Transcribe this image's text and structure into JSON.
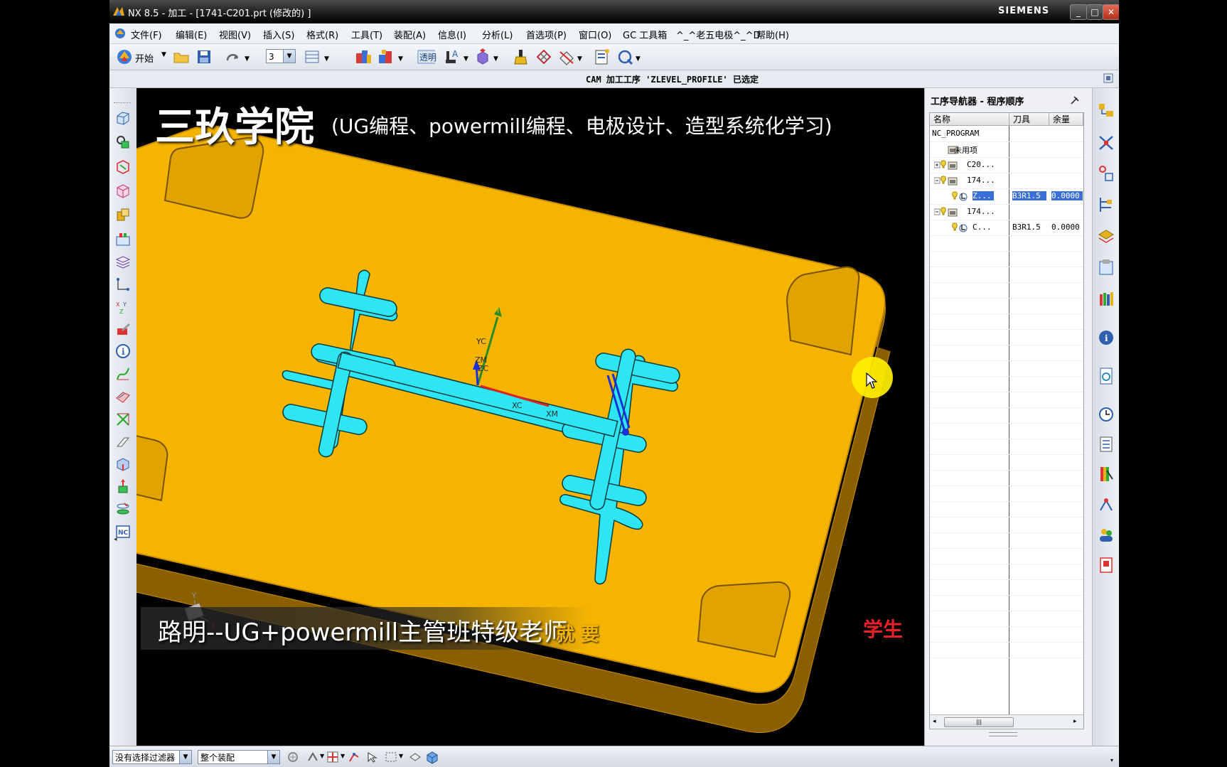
{
  "window": {
    "title": "NX 8.5 - 加工 - [1741-C201.prt (修改的) ]",
    "brand": "SIEMENS",
    "minimize": "_",
    "maximize": "□",
    "close": "✕"
  },
  "menu": [
    "文件(F)",
    "编辑(E)",
    "视图(V)",
    "插入(S)",
    "格式(R)",
    "工具(T)",
    "装配(A)",
    "信息(I)",
    "分析(L)",
    "首选项(P)",
    "窗口(O)",
    "GC 工具箱",
    "^_^老五电极^_^D",
    "帮助(H)"
  ],
  "toolbar": {
    "start_label": "开始",
    "layer_value": "3",
    "transparency_label": "透明"
  },
  "cue_line": "CAM 加工工序 'ZLEVEL_PROFILE' 已选定",
  "overlay": {
    "watermark_title": "三玖学院",
    "watermark_subtitle": "(UG编程、powermill编程、电极设计、造型系统化学习)",
    "caption_left": "路明--UG+powermill主管班特级老师",
    "caption_middle": "就 要",
    "caption_right": "学生"
  },
  "axes": {
    "ym": "YM",
    "yc": "YC",
    "zm": "ZM",
    "zc": "ZC",
    "xc": "XC",
    "xm": "XM",
    "wcs_y": "Y",
    "wcs_x": "X"
  },
  "navigator": {
    "title": "工序导航器 - 程序顺序",
    "columns": [
      "名称",
      "刀具",
      "余量"
    ],
    "rows": [
      {
        "name": "NC_PROGRAM",
        "tool": "",
        "stock": "",
        "level": 0,
        "selected": false
      },
      {
        "name": "未用项",
        "tool": "",
        "stock": "",
        "level": 1,
        "selected": false
      },
      {
        "name": "C20...",
        "tool": "",
        "stock": "",
        "level": 1,
        "selected": false
      },
      {
        "name": "174...",
        "tool": "",
        "stock": "",
        "level": 1,
        "selected": false
      },
      {
        "name": "Z...",
        "tool": "B3R1.5",
        "stock": "0.0000",
        "level": 2,
        "selected": true
      },
      {
        "name": "174...",
        "tool": "",
        "stock": "",
        "level": 1,
        "selected": false
      },
      {
        "name": "C...",
        "tool": "B3R1.5",
        "stock": "0.0000",
        "level": 2,
        "selected": false
      }
    ]
  },
  "status": {
    "filter": "没有选择过滤器",
    "scope": "整个装配"
  },
  "colors": {
    "part": "#f5b400",
    "part_edge": "#c98d00",
    "slot": "#2ee6f2",
    "selection": "#3a6fd8",
    "title_gradient_top": "#4d4d4d"
  }
}
